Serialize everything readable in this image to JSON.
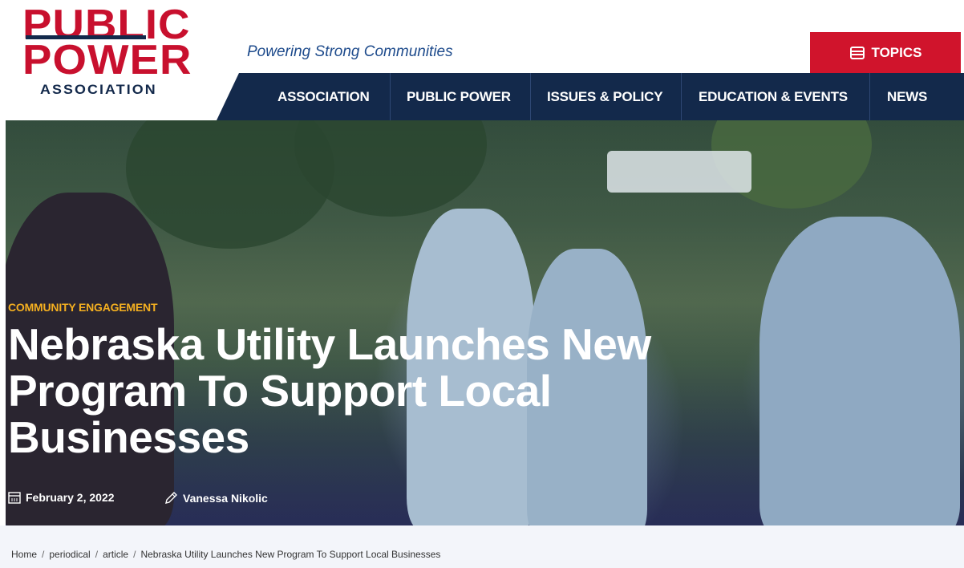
{
  "logo": {
    "line1": "PUBLIC",
    "line2": "POWER",
    "line3": "ASSOCIATION"
  },
  "tagline": "Powering Strong Communities",
  "topics": {
    "label": "TOPICS",
    "icon": "tray-icon"
  },
  "nav": {
    "items": [
      {
        "label": "ASSOCIATION"
      },
      {
        "label": "PUBLIC POWER"
      },
      {
        "label": "ISSUES & POLICY"
      },
      {
        "label": "EDUCATION & EVENTS"
      },
      {
        "label": "NEWS"
      }
    ]
  },
  "article": {
    "category": "COMMUNITY ENGAGEMENT",
    "title": "Nebraska Utility Launches New Program To Support Local Businesses",
    "date": "February 2, 2022",
    "author": "Vanessa Nikolic"
  },
  "breadcrumb": {
    "items": [
      "Home",
      "periodical",
      "article",
      "Nebraska Utility Launches New Program To Support Local Businesses"
    ],
    "separator": "/"
  },
  "colors": {
    "brand_red": "#d0142c",
    "brand_navy": "#13294b",
    "accent_gold": "#f5b020"
  }
}
